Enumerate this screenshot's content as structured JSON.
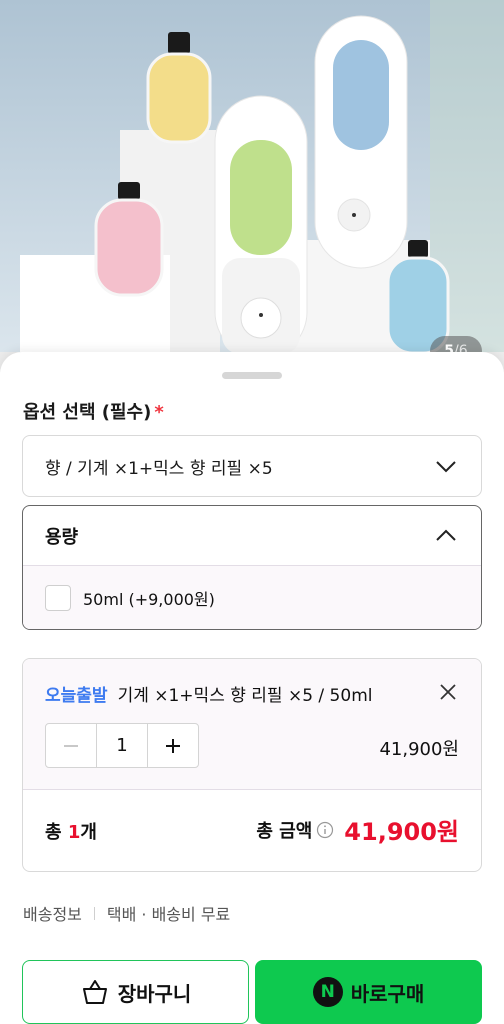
{
  "gallery": {
    "current": "5",
    "separator": "/",
    "total": "6"
  },
  "options": {
    "title": "옵션 선택 (필수)",
    "required_mark": "*",
    "selected_value": "향 / 기계 ×1+믹스 향 리필 ×5",
    "capacity": {
      "label": "용량",
      "choice": "50ml (+9,000원)"
    }
  },
  "selection": {
    "tag": "오늘출발",
    "name": "기계 ×1+믹스 향 리필 ×5 / 50ml",
    "quantity": "1",
    "price": "41,900원",
    "total_prefix": "총 ",
    "total_count": "1",
    "total_suffix": "개",
    "total_label": "총 금액",
    "total_amount": "41,900원"
  },
  "shipping": {
    "label": "배송정보",
    "value": "택배 · 배송비 무료"
  },
  "actions": {
    "cart_label": "장바구니",
    "buy_label": "바로구매",
    "buy_badge": "N"
  },
  "colors": {
    "accent_green": "#0ec94f",
    "price_red": "#e8102e",
    "tag_blue": "#3e7bf0"
  }
}
